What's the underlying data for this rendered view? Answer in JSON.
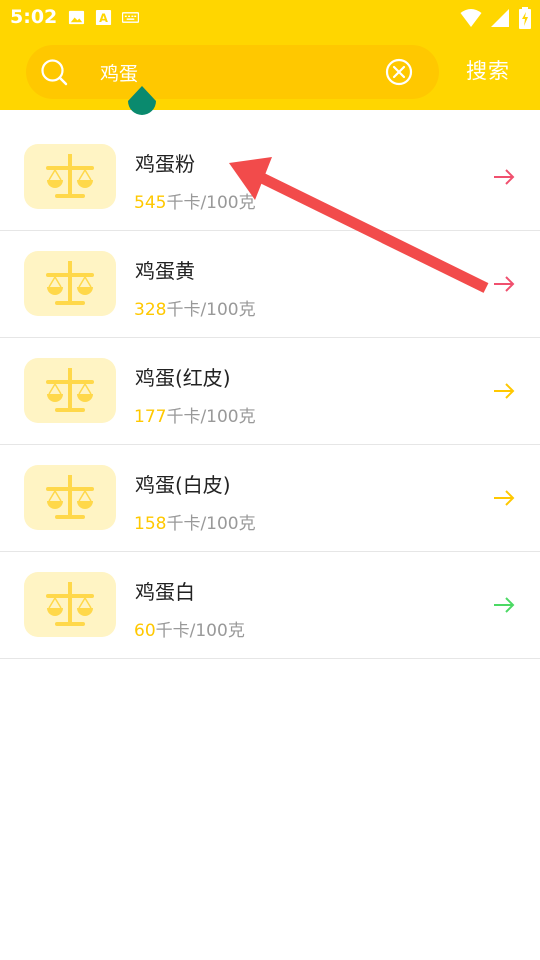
{
  "status_bar": {
    "time": "5:02",
    "left_icons": [
      "image-icon",
      "a-box-icon",
      "keyboard-icon"
    ],
    "right_icons": [
      "wifi-icon",
      "signal-icon",
      "battery-charging-icon"
    ]
  },
  "search": {
    "query": "鸡蛋",
    "button_label": "搜索"
  },
  "results": [
    {
      "name": "鸡蛋粉",
      "calories": "545",
      "unit": "千卡/100克",
      "arrow_color": "#F0506E"
    },
    {
      "name": "鸡蛋黄",
      "calories": "328",
      "unit": "千卡/100克",
      "arrow_color": "#F0506E"
    },
    {
      "name": "鸡蛋(红皮)",
      "calories": "177",
      "unit": "千卡/100克",
      "arrow_color": "#FFC800"
    },
    {
      "name": "鸡蛋(白皮)",
      "calories": "158",
      "unit": "千卡/100克",
      "arrow_color": "#FFC800"
    },
    {
      "name": "鸡蛋白",
      "calories": "60",
      "unit": "千卡/100克",
      "arrow_color": "#4CD964"
    }
  ],
  "colors": {
    "header": "#FFD600",
    "search_box": "#FFC800",
    "icon_bg": "#FFF4C4",
    "icon_fg": "#FFD84A",
    "calorie_number": "#FFC800",
    "caret_handle": "#0A8A6E",
    "annotation_arrow": "#F24B4B"
  }
}
